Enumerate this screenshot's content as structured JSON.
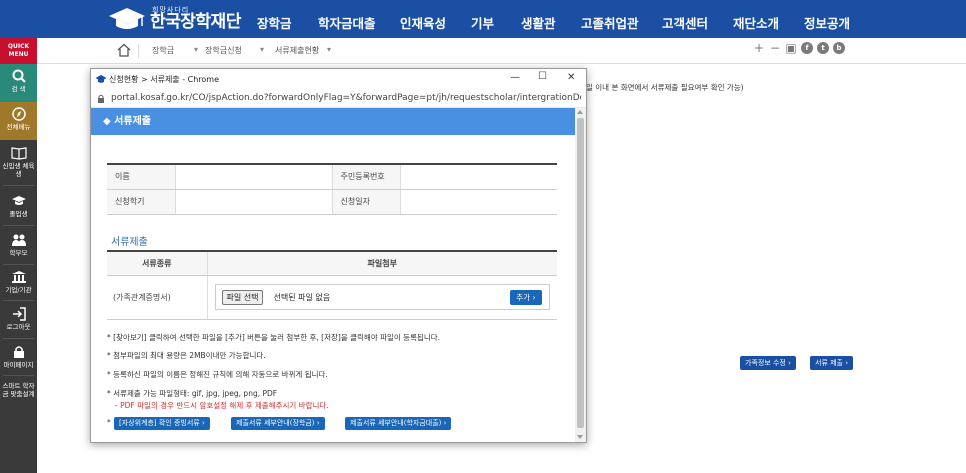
{
  "site": {
    "logo_small": "희망사다리",
    "logo_text": "한국장학재단",
    "nav": [
      "장학금",
      "학자금대출",
      "인재육성",
      "기부",
      "생활관",
      "고졸취업관",
      "고객센터",
      "재단소개",
      "정보공개"
    ]
  },
  "sidebar": {
    "quick_menu": "QUICK MENU",
    "items": [
      {
        "label": "검 색",
        "icon": "search-icon"
      },
      {
        "label": "전체메뉴",
        "icon": "compass-icon"
      },
      {
        "label": "신입생 체육생",
        "icon": "book-icon"
      },
      {
        "label": "졸업생",
        "icon": "graduation-cap-icon"
      },
      {
        "label": "학부모",
        "icon": "parents-icon"
      },
      {
        "label": "기업/기관",
        "icon": "institution-icon"
      },
      {
        "label": "로그아웃",
        "icon": "logout-icon"
      },
      {
        "label": "마이페이지",
        "icon": "lock-icon"
      },
      {
        "label": "스마트 학자금 맞춤설계",
        "icon": "smart-plan-icon"
      }
    ]
  },
  "breadcrumb": {
    "items": [
      "장학금",
      "장학금신청",
      "서류제출현황"
    ],
    "tools": [
      "+",
      "−"
    ]
  },
  "background": {
    "note": "일 이내 본 화면에서 서류제출 필요여부 확인 가능)",
    "buttons": [
      "가족정보 수정",
      "서류 제출"
    ]
  },
  "popup": {
    "window_title": "신청현황 > 서류제출 - Chrome",
    "url": "portal.kosaf.go.kr/CO/jspAction.do?forwardOnlyFlag=Y&forwardPage=pt/jh/requestscholar/intergrationDocmCrst/...",
    "header": "서류제출",
    "info": {
      "name_label": "이름",
      "rrn_label": "주민등록번호",
      "semester_label": "신청학기",
      "date_label": "신청일자"
    },
    "section_title": "서류제출",
    "doc_table": {
      "col_type": "서류종류",
      "col_file": "파일첨부",
      "doc_name": "(가족관계증명서)",
      "file_button": "파일 선택",
      "file_status": "선택된 파일 없음",
      "add_button": "추가"
    },
    "notes": [
      "[찾아보기] 클릭하여 선택한 파일을 [추가] 버튼을 눌러 첨부한 후, [저장]을 클릭해야 파일이 등록됩니다.",
      "첨부파일의 최대 용량은 2MB이내만 가능합니다.",
      "등록하신 파일의 이름은 정해진 규칙에 의해 자동으로 바뀌게 됩니다.",
      "서류제출 가능 파일형태: gif, jpg, jpeg, png, PDF"
    ],
    "pdf_warning": "- PDF 파일의 경우 반드시 암호설정 해제 후 제출해주시기 바랍니다.",
    "links": [
      "[자상위계층] 확인 증빙서류",
      "제출서류 세부안내(장학금)",
      "제출서류 세부안내(학자금대출)"
    ]
  },
  "colors": {
    "nav_bg": "#1a4fa3",
    "header_band": "#4a90e2",
    "button_blue": "#1a66b8",
    "quick_menu_red": "#c8102e",
    "warning_red": "#d0302f"
  }
}
